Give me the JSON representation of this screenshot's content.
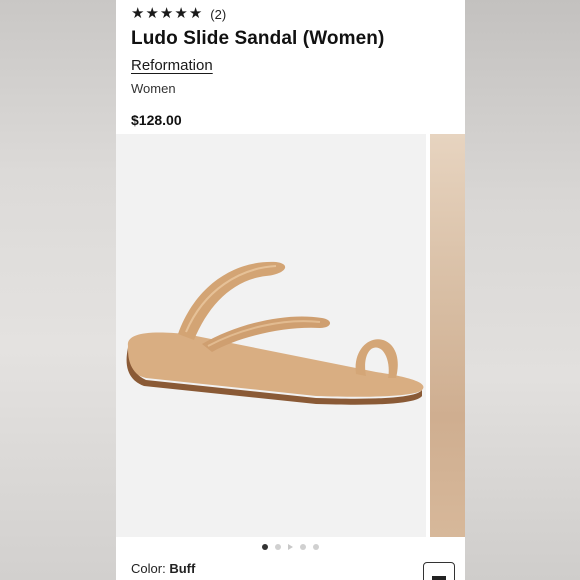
{
  "product": {
    "rating_stars": 5,
    "review_count": "(2)",
    "title": "Ludo Slide Sandal (Women)",
    "brand": "Reformation",
    "category": "Women",
    "price": "$128.00"
  },
  "gallery": {
    "slide_count": 5,
    "active_index": 0
  },
  "variant": {
    "color_label": "Color:",
    "color_value": "Buff"
  },
  "colors": {
    "sandal": "#d7ab7e",
    "background": "#f2f2f2"
  }
}
